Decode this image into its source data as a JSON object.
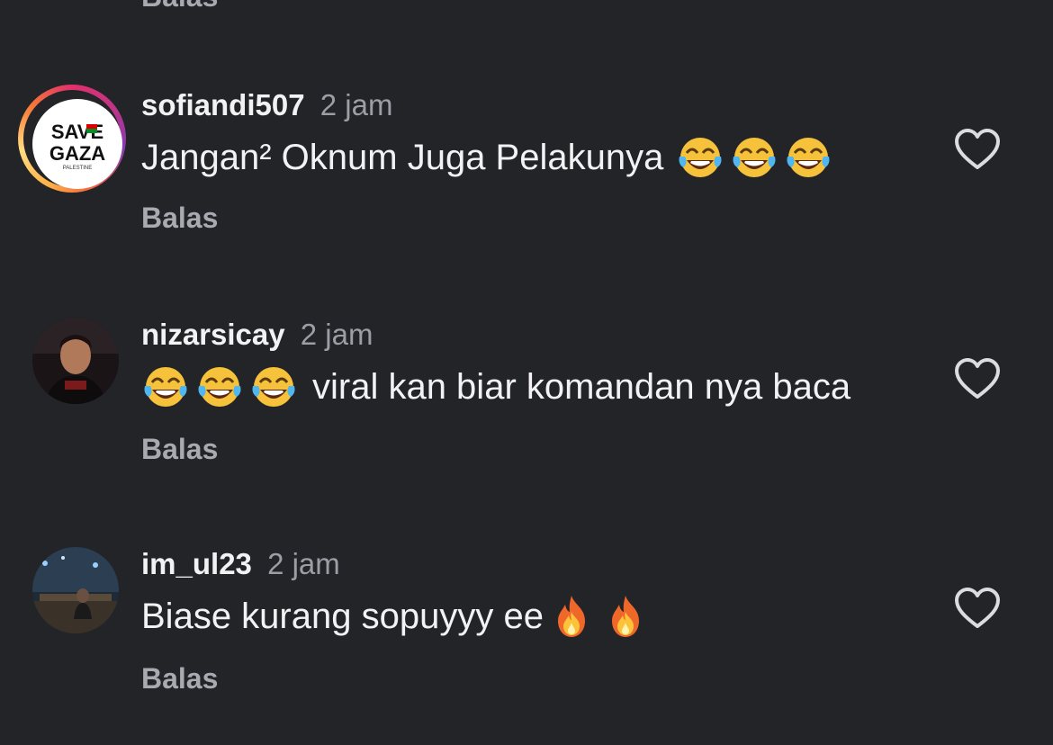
{
  "top_reply_label": "Balas",
  "comments": [
    {
      "username": "sofiandi507",
      "time": "2 jam",
      "text": "Jangan² Oknum Juga Pelakunya",
      "emoji_after": [
        "tears-of-joy",
        "tears-of-joy",
        "tears-of-joy"
      ],
      "avatar_text_line1": "SAVE",
      "avatar_text_line2": "GAZA",
      "avatar_text_line3": "PALESTINE",
      "reply_label": "Balas"
    },
    {
      "username": "nizarsicay",
      "time": "2 jam",
      "emoji_before": [
        "tears-of-joy",
        "tears-of-joy",
        "tears-of-joy"
      ],
      "text": "viral kan biar komandan nya baca",
      "reply_label": "Balas"
    },
    {
      "username": "im_ul23",
      "time": "2 jam",
      "text": "Biase kurang sopuyyy ee",
      "emoji_after": [
        "fire",
        "fire"
      ],
      "reply_label": "Balas"
    }
  ],
  "colors": {
    "background": "#232428",
    "primary_text": "#f2f2f4",
    "secondary_text": "#9c9da5"
  }
}
